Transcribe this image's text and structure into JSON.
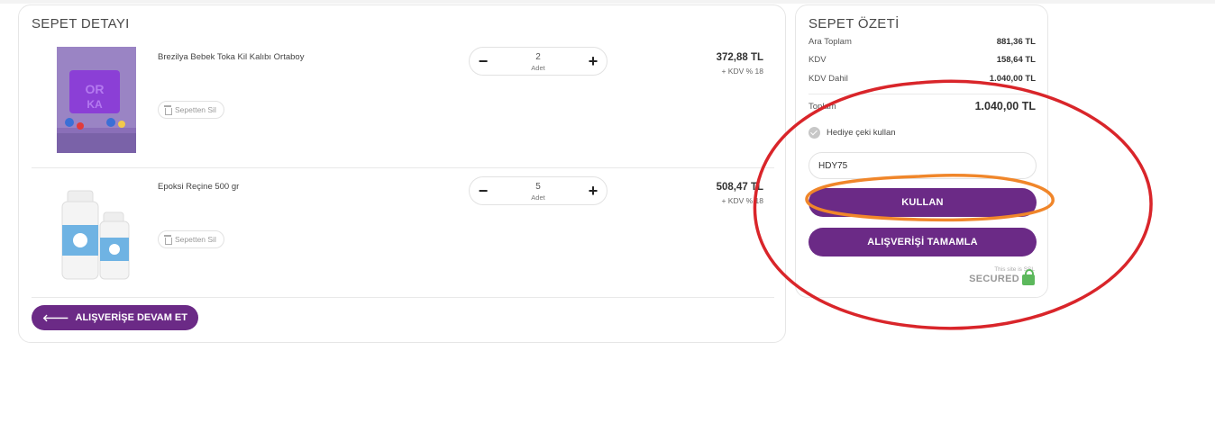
{
  "cart": {
    "title": "SEPET DETAYI",
    "remove_label": "Sepetten Sil",
    "continue_label": "ALIŞVERİŞE DEVAM ET",
    "items": [
      {
        "name": "Brezilya Bebek Toka Kil Kalıbı Ortaboy",
        "quantity": "2",
        "unit": "Adet",
        "price": "372,88 TL",
        "tax": "+ KDV % 18"
      },
      {
        "name": "Epoksi Reçine 500 gr",
        "quantity": "5",
        "unit": "Adet",
        "price": "508,47 TL",
        "tax": "+ KDV % 18"
      }
    ]
  },
  "summary": {
    "title": "SEPET ÖZETİ",
    "rows": [
      {
        "label": "Ara Toplam",
        "value": "881,36 TL"
      },
      {
        "label": "KDV",
        "value": "158,64 TL"
      },
      {
        "label": "KDV Dahil",
        "value": "1.040,00 TL"
      },
      {
        "label": "Toplam",
        "value": "1.040,00 TL"
      }
    ],
    "gift_label": "Hediye çeki kullan",
    "coupon_value": "HDY75",
    "apply_label": "KULLAN",
    "complete_label": "ALIŞVERİŞİ TAMAMLA",
    "ssl_small": "This site is SSL",
    "ssl_big": "SECURED"
  },
  "colors": {
    "accent": "#6b2a86",
    "annotation_red": "#d9252a",
    "annotation_orange": "#f0862a"
  },
  "icons": [
    "minus-icon",
    "plus-icon",
    "trash-icon",
    "arrow-left-icon",
    "check-circle-icon",
    "ssl-lock-icon"
  ]
}
